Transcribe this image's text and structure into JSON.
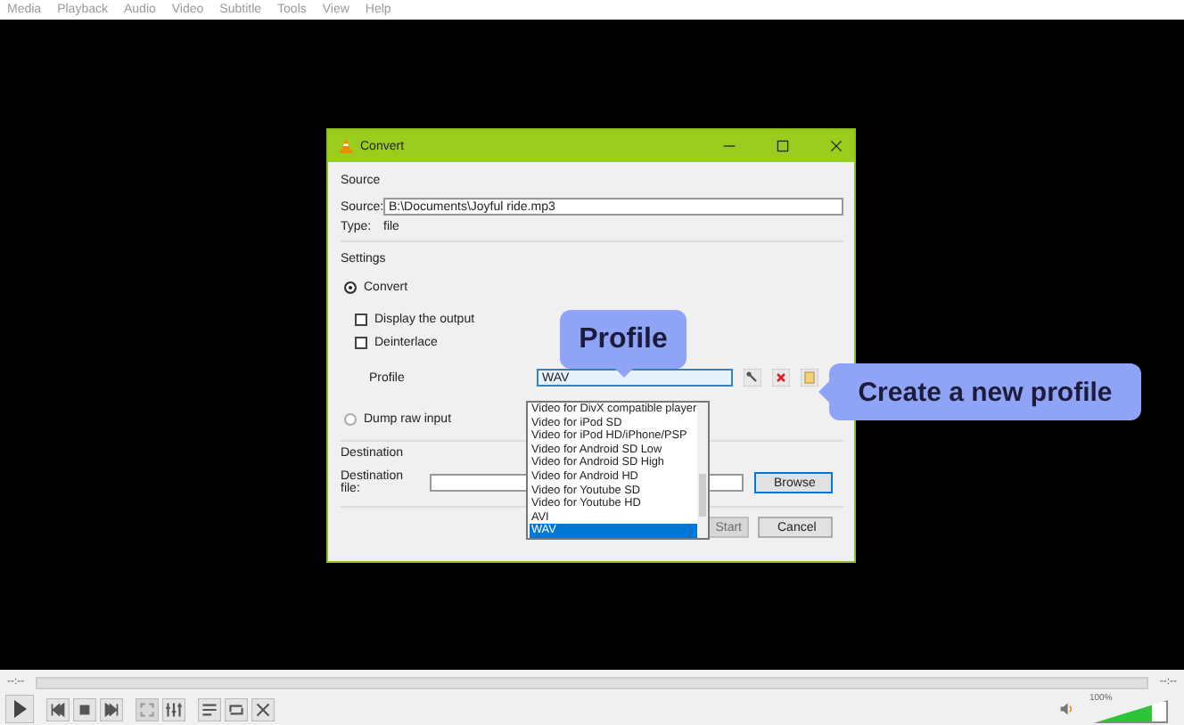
{
  "menu": [
    "Media",
    "Playback",
    "Audio",
    "Video",
    "Subtitle",
    "Tools",
    "View",
    "Help"
  ],
  "dialog": {
    "title": "Convert",
    "source": {
      "heading": "Source",
      "label": "Source:",
      "value": "B:\\Documents\\Joyful ride.mp3",
      "type_label": "Type:",
      "type_value": "file"
    },
    "settings": {
      "heading": "Settings",
      "convert": {
        "label": "Convert",
        "selected": true
      },
      "options": [
        {
          "label": "Display the output",
          "checked": false
        },
        {
          "label": "Deinterlace",
          "checked": false
        }
      ],
      "profile_label": "Profile",
      "profile_value": "WAV",
      "dump": {
        "label": "Dump raw input",
        "selected": false
      }
    },
    "destination": {
      "heading": "Destination",
      "label": "Destination file:",
      "browse": "Browse"
    },
    "buttons": [
      {
        "label": "Start",
        "disabled": true
      },
      {
        "label": "Cancel",
        "disabled": false
      }
    ]
  },
  "dropdown": [
    {
      "label": "Video for DivX compatible player",
      "selected": false
    },
    {
      "label": "Video for iPod SD",
      "selected": false
    },
    {
      "label": "Video for iPod HD/iPhone/PSP",
      "selected": false
    },
    {
      "label": "Video for Android SD Low",
      "selected": false
    },
    {
      "label": "Video for Android SD High",
      "selected": false
    },
    {
      "label": "Video for Android HD",
      "selected": false
    },
    {
      "label": "Video for Youtube SD",
      "selected": false
    },
    {
      "label": "Video for Youtube HD",
      "selected": false
    },
    {
      "label": "AVI",
      "selected": false
    },
    {
      "label": "WAV",
      "selected": true
    }
  ],
  "callouts": [
    {
      "text": "Profile",
      "kind": "down"
    },
    {
      "text": "Create a new profile",
      "kind": "left"
    }
  ],
  "player": {
    "time_left": "--:--",
    "time_right": "--:--",
    "volume": "100%",
    "level": 0.8
  }
}
